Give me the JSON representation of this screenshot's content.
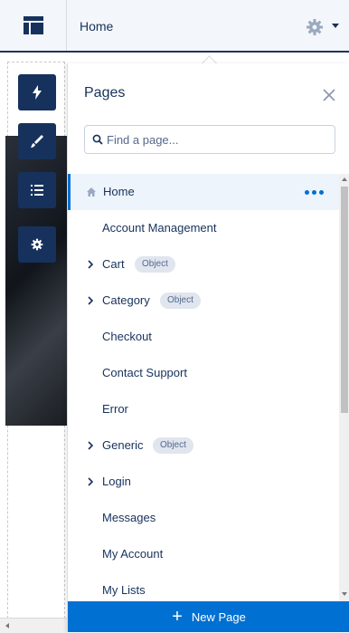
{
  "header": {
    "title": "Home"
  },
  "panel": {
    "title": "Pages",
    "search": {
      "placeholder": "Find a page...",
      "value": ""
    },
    "items": [
      {
        "label": "Home",
        "active": true
      },
      {
        "label": "Account Management"
      },
      {
        "label": "Cart",
        "expandable": true,
        "badge": "Object"
      },
      {
        "label": "Category",
        "expandable": true,
        "badge": "Object"
      },
      {
        "label": "Checkout"
      },
      {
        "label": "Contact Support"
      },
      {
        "label": "Error"
      },
      {
        "label": "Generic",
        "expandable": true,
        "badge": "Object"
      },
      {
        "label": "Login",
        "expandable": true
      },
      {
        "label": "Messages"
      },
      {
        "label": "My Account"
      },
      {
        "label": "My Lists"
      }
    ],
    "new_page_label": "New Page"
  },
  "colors": {
    "brand": "#0070d2",
    "navy": "#16325c",
    "badge_bg": "#e0e5ee"
  },
  "icons": {
    "layout": "layout-icon",
    "gear": "gear-icon",
    "lightning": "lightning-icon",
    "brush": "brush-icon",
    "list": "list-icon",
    "settings": "settings-icon",
    "close": "close-icon",
    "search": "search-icon",
    "home": "home-icon",
    "chevron": "chevron-right-icon",
    "more": "more-icon",
    "plus": "plus-icon"
  }
}
